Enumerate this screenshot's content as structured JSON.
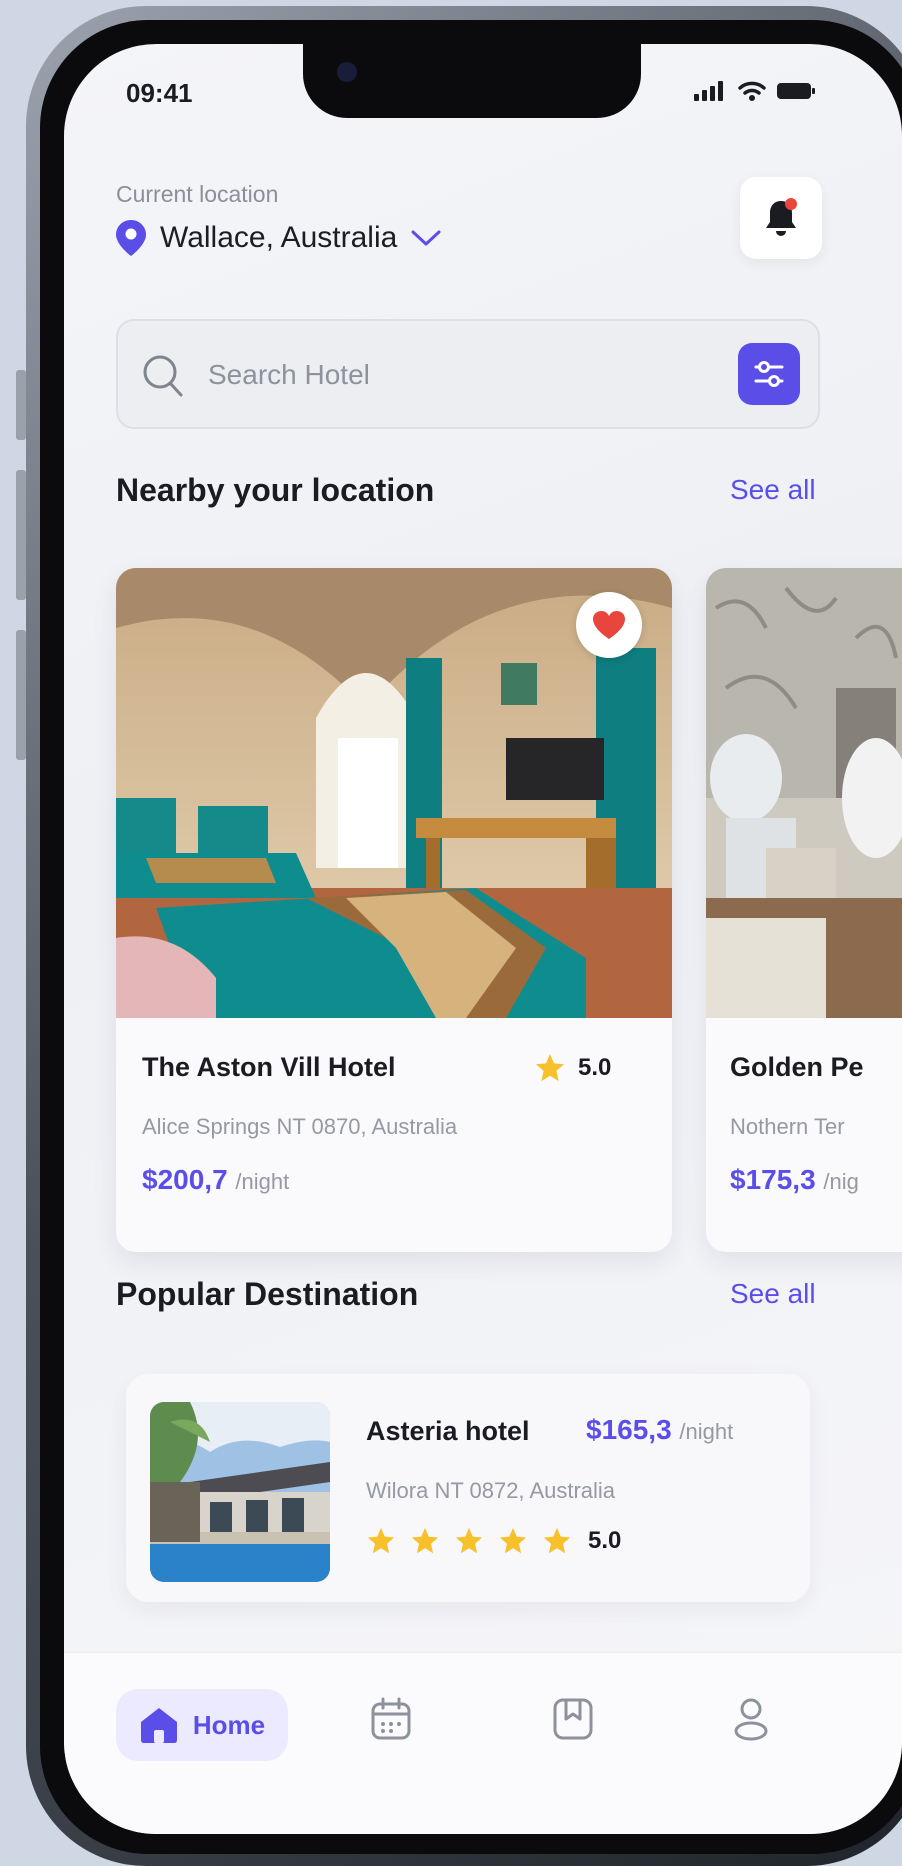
{
  "status_bar": {
    "time": "09:41"
  },
  "header": {
    "location_caption": "Current location",
    "location_value": "Wallace, Australia"
  },
  "search": {
    "placeholder": "Search Hotel"
  },
  "nearby": {
    "title": "Nearby your location",
    "see_all": "See all",
    "hotels": [
      {
        "name": "The Aston Vill Hotel",
        "rating": "5.0",
        "address": "Alice Springs NT 0870, Australia",
        "price": "$200,7",
        "unit": "/night",
        "favorited": true
      },
      {
        "name": "Golden Pe",
        "address": "Nothern Ter",
        "price": "$175,3",
        "unit": "/nig"
      }
    ]
  },
  "popular": {
    "title": "Popular Destination",
    "see_all": "See all",
    "items": [
      {
        "name": "Asteria hotel",
        "price": "$165,3",
        "unit": "/night",
        "address": "Wilora NT 0872, Australia",
        "stars": 5,
        "rating": "5.0"
      }
    ]
  },
  "bottom_nav": {
    "home_label": "Home",
    "items": [
      "home-icon",
      "calendar-icon",
      "bookmark-icon",
      "profile-icon"
    ]
  },
  "colors": {
    "accent": "#5b4ee8",
    "star": "#f6c12b",
    "heart": "#e8453c",
    "teal": "#0f8d8e"
  }
}
